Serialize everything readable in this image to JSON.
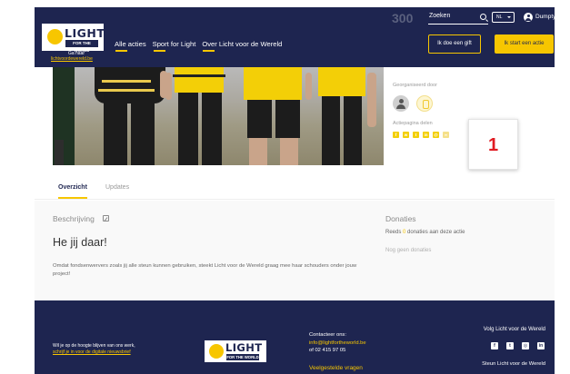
{
  "header": {
    "logo_text": "LIGHT",
    "logo_sub": "FOR THE WORLD",
    "goto_label": "Ga naar",
    "goto_link": "lichtvoordewereld.be",
    "nav": [
      {
        "label": "Alle acties"
      },
      {
        "label": "Sport for Light"
      },
      {
        "label": "Over Licht voor de Wereld"
      }
    ],
    "counter_ghost": "300",
    "search_placeholder": "Zoeken",
    "language": "NL",
    "user_name": "Dumpty",
    "gift_button": "Ik doe een gift",
    "action_button": "Ik start een actie"
  },
  "sidebar": {
    "sponsored_label": "Georganiseerd door",
    "share_label": "Actiepagina delen",
    "share_icons": [
      "facebook-icon",
      "whatsapp-icon",
      "twitter-icon",
      "linkedin-icon",
      "email-icon",
      "link-icon"
    ],
    "annotation_badge": "1"
  },
  "tabs": [
    {
      "label": "Overzicht",
      "active": true
    },
    {
      "label": "Updates",
      "active": false
    }
  ],
  "content": {
    "description_label": "Beschrijving",
    "heading": "He jij daar!",
    "paragraph": "Omdat fondsenwervers zoals jij alle steun kunnen gebruiken, steekt Licht voor de Wereld graag mee haar schouders onder jouw project!"
  },
  "donations": {
    "label": "Donaties",
    "line_prefix": "Reeds",
    "count": "0",
    "line_suffix": "donaties aan deze actie",
    "none": "Nog geen donaties"
  },
  "footer": {
    "newsletter_line1": "Wil je op de hoogte blijven van ons werk,",
    "newsletter_link": "schrijf je in voor de digitale nieuwsbrief",
    "contact_label": "Contacteer ons:",
    "contact_email": "info@lightfortheworld.be",
    "contact_phone": "of 02 415 97 05",
    "questions": "Veelgestelde vragen",
    "follow_label": "Volg Licht voor de Wereld",
    "social_icons": [
      "facebook-icon",
      "twitter-icon",
      "instagram-icon",
      "linkedin-icon"
    ],
    "support_label": "Steun Licht voor de Wereld"
  },
  "colors": {
    "navy": "#1e2550",
    "yellow": "#f7c600",
    "badge_red": "#e01b22"
  }
}
